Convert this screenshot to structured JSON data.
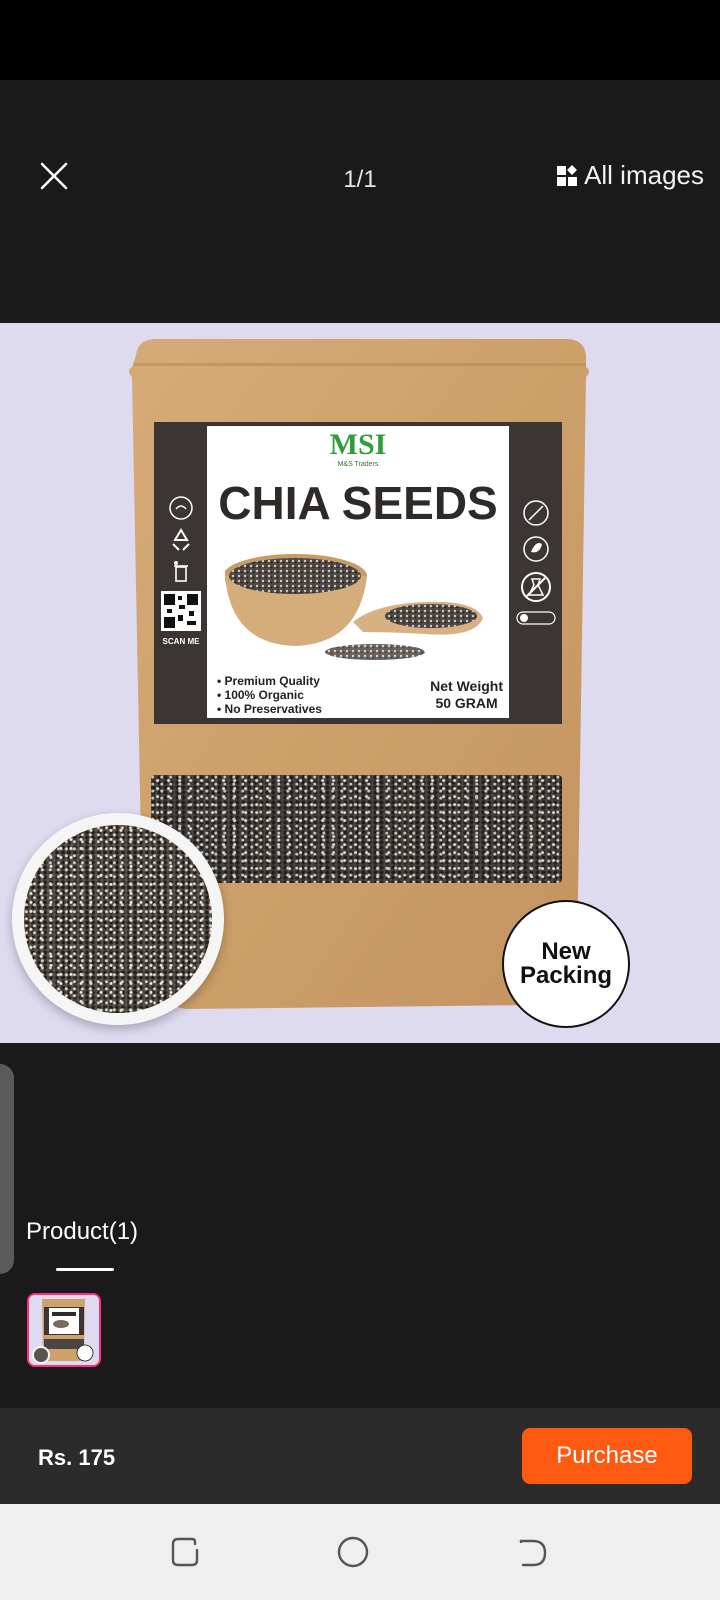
{
  "viewer": {
    "counter": "1/1",
    "all_images_label": "All images"
  },
  "product_image": {
    "brand": "MSI",
    "brand_sub": "M&S Traders",
    "title": "CHIA SEEDS",
    "bullets": [
      "• Premium Quality",
      "• 100% Organic",
      "• No Preservatives"
    ],
    "net_weight_label": "Net Weight",
    "net_weight_value": "50 GRAM",
    "scan_label": "SCAN ME",
    "badge_line1": "New",
    "badge_line2": "Packing"
  },
  "products": {
    "tab_label": "Product(1)"
  },
  "footer": {
    "price": "Rs. 175",
    "purchase_label": "Purchase"
  },
  "colors": {
    "accent": "#ff5a12",
    "thumb_border": "#ff2d7a",
    "viewer_bg": "#dedbf0"
  }
}
